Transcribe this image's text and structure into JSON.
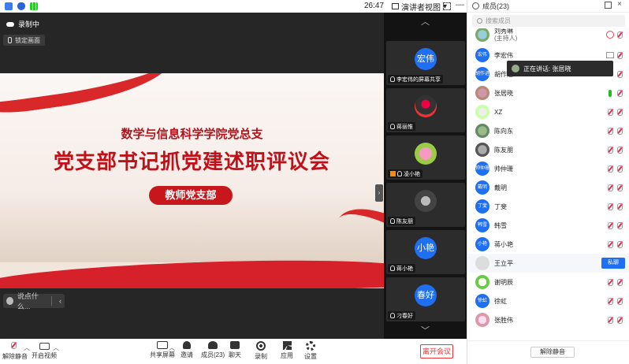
{
  "topbar": {
    "time": "26:47",
    "view_label": "演讲者视图"
  },
  "stage": {
    "recording_label": "录制中",
    "lock_label": "锁定画面",
    "slide": {
      "subtitle": "数学与信息科学学院党总支",
      "title": "党支部书记抓党建述职评议会",
      "org": "教师党支部"
    },
    "comment_placeholder": "说点什么..."
  },
  "strip": {
    "tiles": [
      {
        "initials": "宏伟",
        "name": "李宏伟的屏幕共享"
      },
      {
        "name": "蒋丽惟"
      },
      {
        "name": "凌小艳"
      },
      {
        "name": "陈友朋"
      },
      {
        "initials": "小艳",
        "name": "蒋小艳"
      },
      {
        "initials": "春好",
        "name": "刁春好"
      }
    ]
  },
  "toolbar": {
    "mute": "解除静音",
    "video": "开启视频",
    "share": "共享屏幕",
    "invite": "邀请",
    "members": "成员(23)",
    "chat": "聊天",
    "record": "录制",
    "apps": "应用",
    "settings": "设置",
    "leave": "离开会议"
  },
  "panel": {
    "title": "成员(23)",
    "search_placeholder": "搜索成员",
    "host_tag": "(主持人)",
    "members": [
      {
        "initials": "",
        "name": "刘秀琳"
      },
      {
        "initials": "宏伟",
        "name": "李宏伟"
      },
      {
        "initials": "胡作进",
        "name": "胡作进"
      },
      {
        "initials": "",
        "name": "张居晓"
      },
      {
        "initials": "",
        "name": "XZ"
      },
      {
        "initials": "",
        "name": "陈向东"
      },
      {
        "initials": "",
        "name": "陈友朋"
      },
      {
        "initials": "帅仲珊",
        "name": "帅仲珊"
      },
      {
        "initials": "戴明",
        "name": "戴明"
      },
      {
        "initials": "丁斐",
        "name": "丁斐"
      },
      {
        "initials": "韩雪",
        "name": "韩雪"
      },
      {
        "initials": "小艳",
        "name": "蒋小艳"
      },
      {
        "initials": "",
        "name": "王立平"
      },
      {
        "initials": "",
        "name": "谢明辰"
      },
      {
        "initials": "徐虹",
        "name": "徐虹"
      },
      {
        "initials": "",
        "name": "张胜伟"
      }
    ],
    "unmute_label": "私聊",
    "mute_all": "解除静音"
  },
  "speaking": {
    "label": "正在讲话: 张居晓"
  },
  "colors": {
    "accent": "#1e6ff2",
    "danger": "#e33333",
    "slide_red": "#c0111a"
  }
}
